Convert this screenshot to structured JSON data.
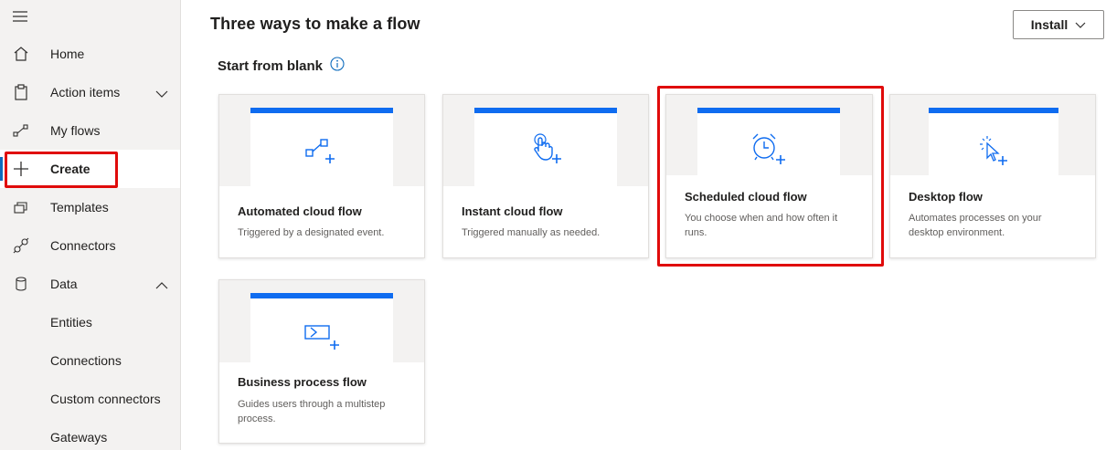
{
  "sidebar": {
    "items": [
      {
        "label": "Home",
        "icon": "home-icon"
      },
      {
        "label": "Action items",
        "icon": "clipboard-icon"
      },
      {
        "label": "My flows",
        "icon": "flow-icon"
      },
      {
        "label": "Create",
        "icon": "plus-icon"
      },
      {
        "label": "Templates",
        "icon": "templates-icon"
      },
      {
        "label": "Connectors",
        "icon": "connector-icon"
      },
      {
        "label": "Data",
        "icon": "database-icon"
      },
      {
        "label": "Entities"
      },
      {
        "label": "Connections"
      },
      {
        "label": "Custom connectors"
      },
      {
        "label": "Gateways"
      }
    ]
  },
  "header": {
    "title": "Three ways to make a flow",
    "install_label": "Install"
  },
  "section": {
    "title": "Start from blank"
  },
  "cards": [
    {
      "title": "Automated cloud flow",
      "desc": "Triggered by a designated event.",
      "icon": "automated-flow-icon"
    },
    {
      "title": "Instant cloud flow",
      "desc": "Triggered manually as needed.",
      "icon": "touch-icon"
    },
    {
      "title": "Scheduled cloud flow",
      "desc": "You choose when and how often it runs.",
      "icon": "alarm-clock-icon"
    },
    {
      "title": "Desktop flow",
      "desc": "Automates processes on your desktop environment.",
      "icon": "cursor-click-icon"
    },
    {
      "title": "Business process flow",
      "desc": "Guides users through a multistep process.",
      "icon": "process-icon"
    }
  ],
  "colors": {
    "accent": "#0f6cf0",
    "highlight": "#e00b0b"
  }
}
